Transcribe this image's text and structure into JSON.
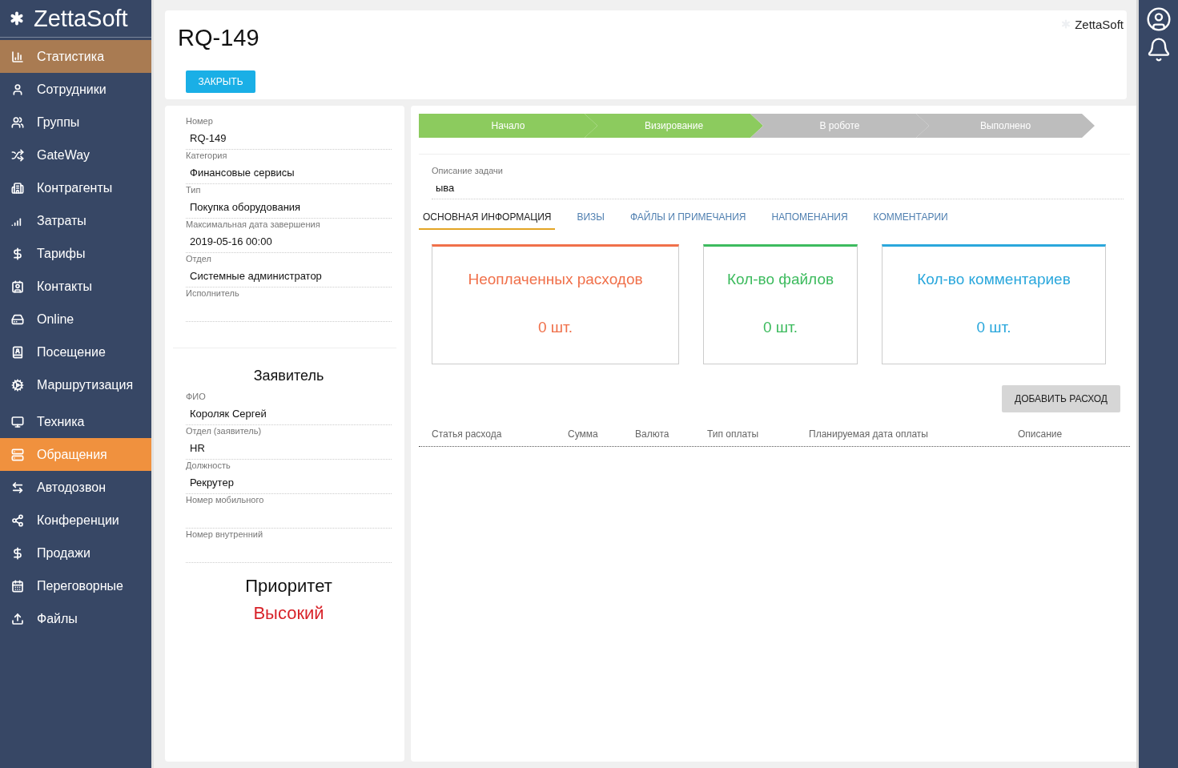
{
  "sidebar": {
    "logo": "ZettaSoft",
    "items": [
      {
        "label": "Статистика",
        "selected": false,
        "hovered": true
      },
      {
        "label": "Сотрудники",
        "selected": false,
        "hovered": false
      },
      {
        "label": "Группы",
        "selected": false,
        "hovered": false
      },
      {
        "label": "GateWay",
        "selected": false,
        "hovered": false
      },
      {
        "label": "Контрагенты",
        "selected": false,
        "hovered": false
      },
      {
        "label": "Затраты",
        "selected": false,
        "hovered": false
      },
      {
        "label": "Тарифы",
        "selected": false,
        "hovered": false
      },
      {
        "label": "Контакты",
        "selected": false,
        "hovered": false
      },
      {
        "label": "Online",
        "selected": false,
        "hovered": false
      },
      {
        "label": "Посещение",
        "selected": false,
        "hovered": false
      },
      {
        "label": "Маршрутизация",
        "selected": false,
        "hovered": false
      },
      {
        "label": "Техника",
        "selected": false,
        "hovered": false
      },
      {
        "label": "Обращения",
        "selected": true,
        "hovered": false
      },
      {
        "label": "Автодозвон",
        "selected": false,
        "hovered": false
      },
      {
        "label": "Конференции",
        "selected": false,
        "hovered": false
      },
      {
        "label": "Продажи",
        "selected": false,
        "hovered": false
      },
      {
        "label": "Переговорные",
        "selected": false,
        "hovered": false
      },
      {
        "label": "Файлы",
        "selected": false,
        "hovered": false
      }
    ]
  },
  "header": {
    "title": "RQ-149",
    "close_button": "ЗАКРЫТЬ",
    "brand": "ZettaSoft"
  },
  "details": {
    "fields": [
      {
        "label": "Номер",
        "value": "RQ-149"
      },
      {
        "label": "Категория",
        "value": "Финансовые сервисы"
      },
      {
        "label": "Тип",
        "value": "Покупка оборудования"
      },
      {
        "label": "Максимальная дата завершения",
        "value": "2019-05-16 00:00"
      },
      {
        "label": "Отдел",
        "value": "Системные администратор"
      },
      {
        "label": "Исполнитель"
      }
    ]
  },
  "applicant": {
    "title": "Заявитель",
    "fields": [
      {
        "label": "ФИО",
        "value": "Короляк Сергей"
      },
      {
        "label": "Отдел (заявитель)",
        "value": "HR"
      },
      {
        "label": "Должность",
        "value": "Рекрутер"
      },
      {
        "label": "Номер мобильного"
      },
      {
        "label": "Номер внутренний"
      }
    ]
  },
  "priority": {
    "title": "Приоритет",
    "value": "Высокий"
  },
  "stages": [
    {
      "label": "Начало",
      "done": true
    },
    {
      "label": "Визирование",
      "done": true
    },
    {
      "label": "В роботе",
      "done": false
    },
    {
      "label": "Выполнено",
      "done": false
    }
  ],
  "description": {
    "label": "Описание задачи",
    "value": "ыва"
  },
  "tabs": [
    {
      "label": "ОСНОВНАЯ ИНФОРМАЦИЯ",
      "selected": true
    },
    {
      "label": "ВИЗЫ",
      "selected": false
    },
    {
      "label": "ФАЙЛЫ И ПРИМЕЧАНИЯ",
      "selected": false
    },
    {
      "label": "НАПОМЕНАНИЯ",
      "selected": false
    },
    {
      "label": "КОММЕНТАРИИ",
      "selected": false
    }
  ],
  "stat_cards": [
    {
      "title": "Неоплаченных расходов",
      "count": "0 шт.",
      "color": "#f0704a"
    },
    {
      "title": "Кол-во файлов",
      "count": "0 шт.",
      "color": "#3dbb5e"
    },
    {
      "title": "Кол-во комментариев",
      "count": "0 шт.",
      "color": "#2aa7dc"
    }
  ],
  "add_expense_button": "ДОБАВИТЬ РАСХОД",
  "expenses_table": {
    "columns": [
      "Статья расхода",
      "Сумма",
      "Валюта",
      "Тип оплаты",
      "Планируемая дата оплаты",
      "Описание"
    ]
  }
}
